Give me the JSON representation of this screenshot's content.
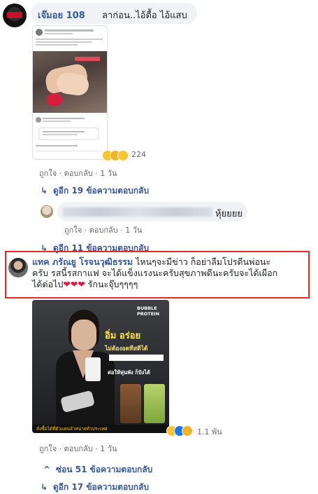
{
  "comments": [
    {
      "author": "เจ๊มอย 108",
      "text": "ลาก่อน..ไอ้ตื้อ ไอ้แสบ",
      "reaction_count": "224",
      "actions": {
        "like": "ถูกใจ",
        "reply": "ตอบกลับ",
        "time": "1 วัน"
      },
      "more_replies": "ดูอีก 19 ข้อความตอบกลับ"
    },
    {
      "author": "",
      "text": "หุ้ยยยย",
      "actions": {
        "like": "ถูกใจ",
        "reply": "ตอบกลับ",
        "time": "1 วัน"
      },
      "more_replies": "ดูอีก 11 ข้อความตอบกลับ"
    },
    {
      "author": "แทค ภรัณยู โรจนวุฒิธรรม",
      "text_line1": " ไหนๆจะมีข่าว ก็อย่าลืมโปรดีนพ่อนะ",
      "text_line2": "ครับ รสนี้รสกาแฟ จะได้แข็งแรงนะครับสุขภาพดีนะครับจะได้เผือก",
      "text_line3_a": "ได้ต่อไป",
      "text_line3_hearts": "❤❤❤",
      "text_line3_b": " รักนะจุ๊บๆๆๆๆ",
      "ad_brand": "BUBBLE PROTEIN",
      "ad_headline": "อิ่ม อร่อย",
      "ad_sub": "ไม่ต้องอดทีสติได้",
      "ad_tag": "ต่อให้หุ่นพัง ก็ปังได้",
      "ad_footer": "สั่งซื้อได้ที่ตัวแทนจำหน่ายทั่วประเทศ",
      "reaction_count": "1.1 พัน",
      "actions": {
        "like": "ถูกใจ",
        "reply": "ตอบกลับ",
        "time": "1 วัน"
      },
      "hide_replies": "ซ่อน 51 ข้อความตอบกลับ",
      "more_replies": "ดูอีก 17 ข้อความตอบกลับ"
    }
  ],
  "colors": {
    "link": "#385898",
    "highlight": "#e02b2b",
    "bubble": "#f0f2f5",
    "heart": "#e0173f"
  },
  "icons": [
    "reply-arrow-icon",
    "hide-arrow-icon",
    "haha-reaction-icon",
    "wow-reaction-icon",
    "like-reaction-icon",
    "love-reaction-icon"
  ]
}
